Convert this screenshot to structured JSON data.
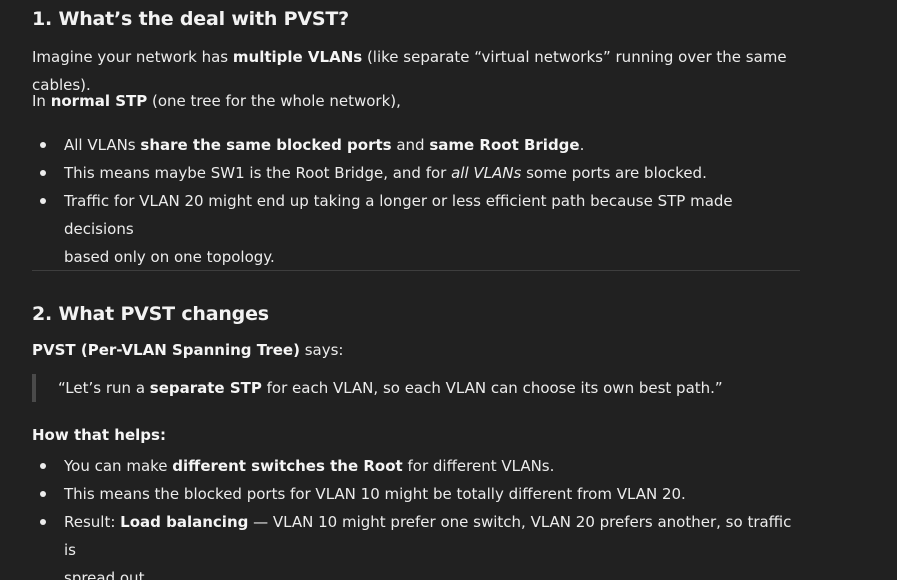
{
  "section1": {
    "heading": "1. What’s the deal with PVST?",
    "intro": {
      "pre": "Imagine your network has ",
      "bold": "multiple VLANs",
      "post": " (like separate “virtual networks” running over the same cables)."
    },
    "normal": {
      "pre": "In ",
      "bold": "normal STP",
      "post": " (one tree for the whole network),"
    },
    "bullets": [
      {
        "pre": "All VLANs ",
        "bold1": "share the same blocked ports",
        "mid": " and ",
        "bold2": "same Root Bridge",
        "post": "."
      },
      {
        "pre": "This means maybe SW1 is the Root Bridge, and for ",
        "italic": "all VLANs",
        "post": " some ports are blocked."
      },
      {
        "line1": "Traffic for VLAN 20 might end up taking a longer or less efficient path because STP made decisions",
        "line2": "based only on one topology."
      }
    ]
  },
  "section2": {
    "heading": "2. What PVST changes",
    "says": {
      "bold": "PVST (Per-VLAN Spanning Tree)",
      "post": " says:"
    },
    "quote": {
      "pre": "“Let’s run a ",
      "bold": "separate STP",
      "post": " for each VLAN, so each VLAN can choose its own best path.”"
    },
    "helps_label": "How that helps:",
    "bullets": [
      {
        "pre": "You can make ",
        "bold": "different switches the Root",
        "post": " for different VLANs."
      },
      {
        "text": "This means the blocked ports for VLAN 10 might be totally different from VLAN 20."
      },
      {
        "pre": "Result: ",
        "bold": "Load balancing",
        "post": " — VLAN 10 might prefer one switch, VLAN 20 prefers another, so traffic is",
        "line2": "spread out."
      }
    ]
  }
}
